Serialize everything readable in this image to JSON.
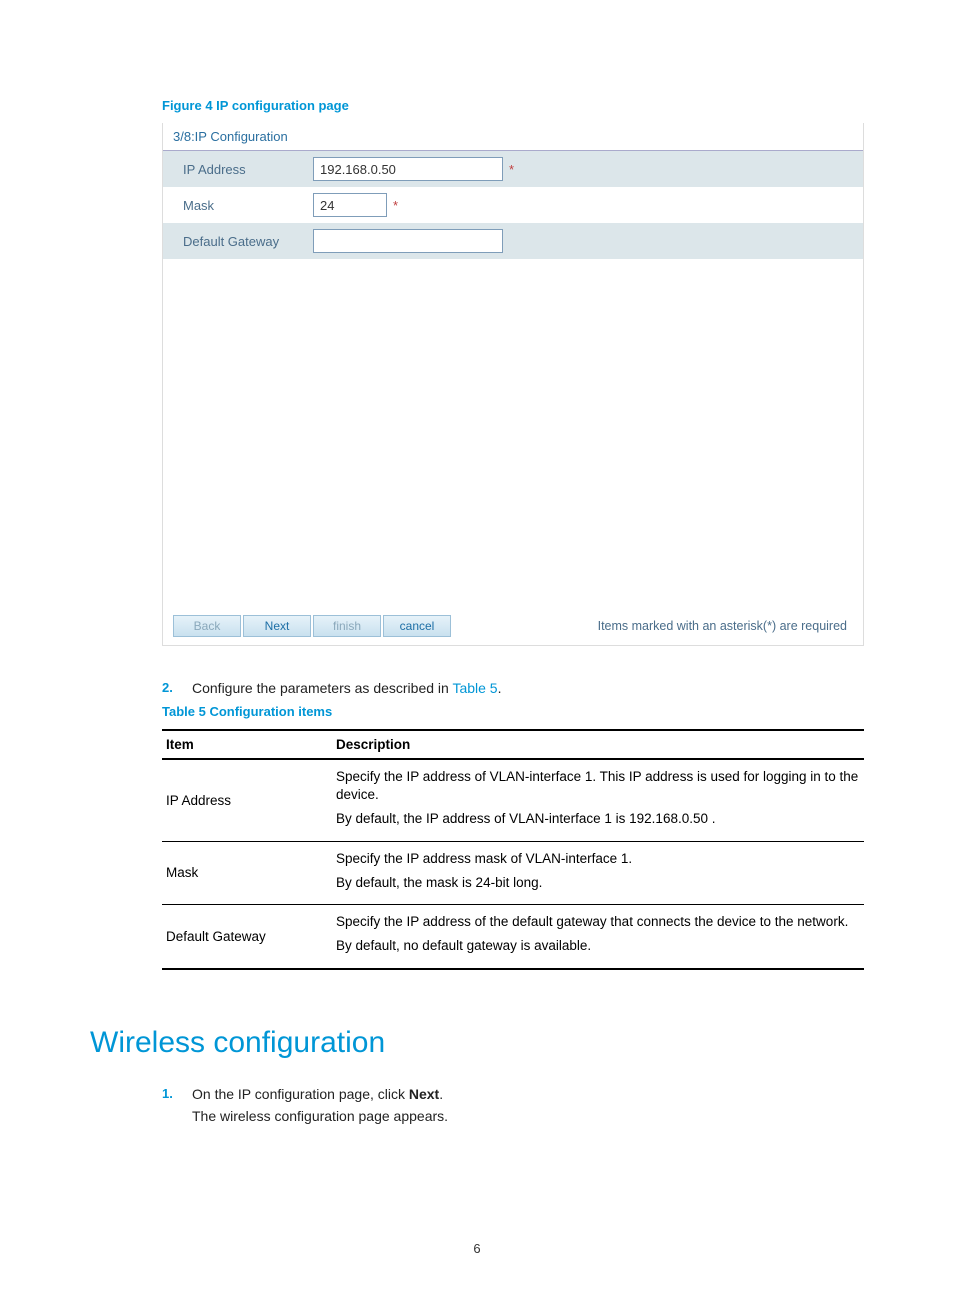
{
  "figure4": {
    "caption": "Figure 4 IP configuration page",
    "header": "3/8:IP Configuration",
    "rows": {
      "ip_label": "IP Address",
      "ip_value": "192.168.0.50",
      "mask_label": "Mask",
      "mask_value": "24",
      "gw_label": "Default Gateway",
      "gw_value": ""
    },
    "asterisk": "*",
    "buttons": {
      "back": "Back",
      "next": "Next",
      "finish": "finish",
      "cancel": "cancel"
    },
    "required_note": "Items marked with an asterisk(*) are required"
  },
  "step2": {
    "num": "2.",
    "text_prefix": "Configure the parameters as described in ",
    "link": "Table 5",
    "text_suffix": "."
  },
  "table5": {
    "caption": "Table 5 Configuration items",
    "head_item": "Item",
    "head_desc": "Description",
    "rows": [
      {
        "item": "IP Address",
        "desc1": "Specify the IP address of VLAN-interface 1. This IP address is used for logging in to the device.",
        "desc2": "By default, the IP address of VLAN-interface 1 is 192.168.0.50 ."
      },
      {
        "item": "Mask",
        "desc1": "Specify the IP address mask of VLAN-interface 1.",
        "desc2": "By default, the mask is 24-bit long."
      },
      {
        "item": "Default Gateway",
        "desc1": "Specify the IP address of the default gateway that connects the device to the network.",
        "desc2": "By default, no default gateway is available."
      }
    ]
  },
  "wireless": {
    "heading": "Wireless configuration",
    "step1_num": "1.",
    "step1_text_prefix": "On the IP configuration page, click ",
    "step1_bold": "Next",
    "step1_text_suffix": ".",
    "step1_sub": "The wireless configuration page appears."
  },
  "page_number": "6"
}
